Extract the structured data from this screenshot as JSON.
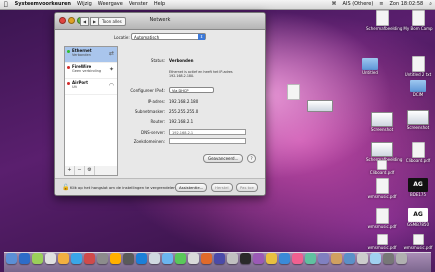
{
  "menubar": {
    "app": "Systeemvoorkeuren",
    "items": [
      "Wijzig",
      "Weergave",
      "Venster",
      "Help"
    ],
    "right": [
      "⌘",
      "AIS (Othere)",
      "≡",
      "Zon 18:02:58",
      "⌕"
    ]
  },
  "window": {
    "title": "Netwerk",
    "show_all": "Toon alles",
    "location_label": "Locatie:",
    "location_value": "Automatisch",
    "services": [
      {
        "name": "Ethernet",
        "sub": "Verbonden",
        "status_color": "#2fbf2f",
        "icon": "⇄"
      },
      {
        "name": "FireWire",
        "sub": "Geen verbinding",
        "status_color": "#d12b2b",
        "icon": "✦"
      },
      {
        "name": "AirPort",
        "sub": "Uit",
        "status_color": "#d12b2b",
        "icon": "◠"
      }
    ],
    "status_label": "Status:",
    "status_value": "Verbonden",
    "status_desc": "Ethernet is actief en heeft het IP-adres 192.168.2.180.",
    "configure_label": "Configureer IPv4:",
    "configure_value": "Via DHCP",
    "ip_label": "IP-adres:",
    "ip_value": "192.168.2.180",
    "subnet_label": "Subnetmasker:",
    "subnet_value": "255.255.255.0",
    "router_label": "Router:",
    "router_value": "192.168.2.1",
    "dns_label": "DNS-server:",
    "dns_value": "192.168.2.1",
    "search_label": "Zoekdomeinen:",
    "search_value": "",
    "advanced": "Geavanceerd...",
    "help": "?",
    "lock_text": "Klik op het hangslot om de instellingen te vergrendelen.",
    "assistant": "Assistentie...",
    "revert": "Herstel",
    "apply": "Pas toe",
    "add": "+",
    "remove": "−",
    "gear": "⚙"
  },
  "desktop_icons": [
    {
      "label": "Schermafbeelding",
      "kind": "doc"
    },
    {
      "label": "My Bom Camp",
      "kind": "doc"
    },
    {
      "label": "Untitled",
      "kind": "folder"
    },
    {
      "label": "Untitled 2 txt",
      "kind": "doc"
    },
    {
      "label": "DCIM",
      "kind": "folder"
    },
    {
      "label": "Screenshot",
      "kind": "thumb"
    },
    {
      "label": "Screenshot",
      "kind": "thumb"
    },
    {
      "label": "Schermafbeelding",
      "kind": "thumb"
    },
    {
      "label": "Cliboard.pdf",
      "kind": "doc"
    },
    {
      "label": "Cliboard.pdf",
      "kind": "doc"
    },
    {
      "label": "wmsmusic.pdf",
      "kind": "doc"
    },
    {
      "label": "BDE175",
      "kind": "dark"
    },
    {
      "label": "wmsmusic.pdf",
      "kind": "doc"
    },
    {
      "label": "GSMB7850",
      "kind": "white"
    },
    {
      "label": "wmsmusic.pdf",
      "kind": "doc"
    },
    {
      "label": "wmsmusic.pdf",
      "kind": "doc"
    }
  ],
  "dock": {
    "colors": [
      "#5b8fd6",
      "#2d6cc8",
      "#9bcf5a",
      "#e0e0e0",
      "#f2b040",
      "#3aa6e8",
      "#d04a4a",
      "#8c8c8c",
      "#ffb000",
      "#5a5a5a",
      "#1c7fd8",
      "#cfd8e0",
      "#6bb5f0",
      "#5ac85a",
      "#d9d9d9",
      "#e06a2a",
      "#4a4aa8",
      "#c0c0c0",
      "#2a2a2a",
      "#9b59b6",
      "#e8c040",
      "#3a8ad8",
      "#f06090",
      "#60c0a0",
      "#8080c0",
      "#d0a060",
      "#5a90c8",
      "#cccccc",
      "#a0d0f0",
      "#777777",
      "#b0b0b0"
    ]
  }
}
